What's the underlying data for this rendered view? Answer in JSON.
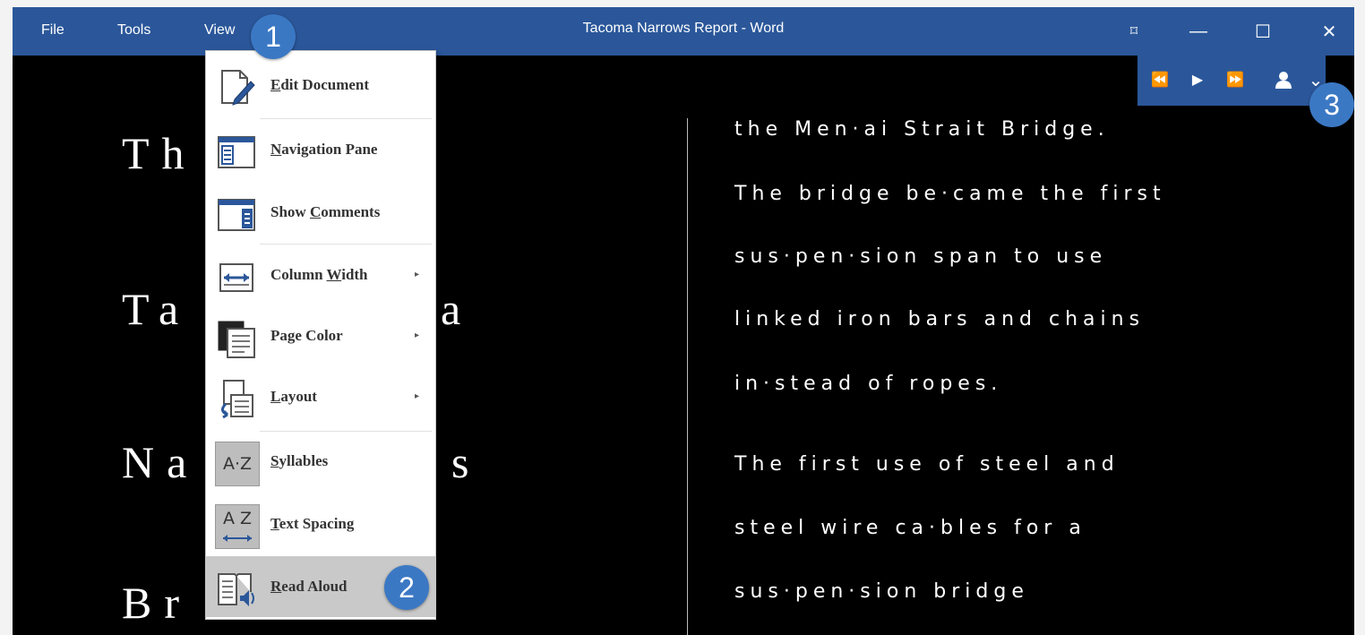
{
  "titlebar": {
    "menus": [
      "File",
      "Tools",
      "View"
    ],
    "doc_title": "Tacoma Narrows Report  -  Word",
    "controls": {
      "focus": "⌑",
      "minimize": "—",
      "maximize": "☐",
      "close": "✕"
    }
  },
  "read_toolbar": {
    "previous": "⏪",
    "play": "▶",
    "next": "⏩",
    "voice": "👤",
    "more": "⌄"
  },
  "document": {
    "left_words": [
      "Th",
      "Ta",
      "a",
      "Na",
      "s",
      "Br"
    ],
    "right_lines": [
      "the Men·ai Strait Bridge.",
      "The bridge be·came the first",
      "sus·pen·sion span to use",
      "linked iron bars and chains",
      "in·stead of ropes.",
      "The first use of steel and",
      "steel wire ca·bles for a",
      "sus·pen·sion bridge"
    ]
  },
  "view_menu": {
    "items": [
      {
        "pre": "",
        "ul": "E",
        "post": "dit Document"
      },
      {
        "pre": "",
        "ul": "N",
        "post": "avigation Pane"
      },
      {
        "pre": "Show ",
        "ul": "C",
        "post": "omments"
      },
      {
        "pre": "Column ",
        "ul": "W",
        "post": "idth"
      },
      {
        "pre": "Page Color",
        "ul": "",
        "post": ""
      },
      {
        "pre": "",
        "ul": "L",
        "post": "ayout"
      },
      {
        "pre": "",
        "ul": "S",
        "post": "yllables"
      },
      {
        "pre": "",
        "ul": "T",
        "post": "ext Spacing"
      },
      {
        "pre": "",
        "ul": "R",
        "post": "ead Aloud"
      }
    ],
    "submenu_arrow": "▸",
    "az_icon_text": "A·Z",
    "az_spacing_text": "A Z",
    "highlight_color": "#c9c9c9"
  },
  "callouts": [
    "1",
    "2",
    "3"
  ],
  "colors": {
    "titlebar": "#2b579a",
    "callout": "#3b78c4",
    "page": "#000000"
  }
}
